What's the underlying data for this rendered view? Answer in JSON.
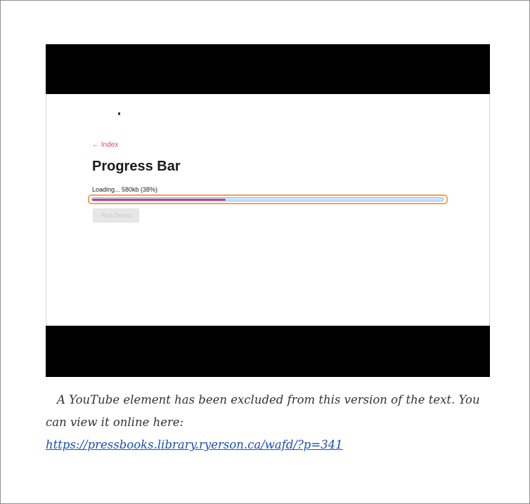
{
  "video": {
    "screen": {
      "index_link": "← Index",
      "title": "Progress Bar",
      "loading_text": "Loading... 580kb (38%)",
      "progress_percent": 38,
      "button_label": "Run Demo"
    }
  },
  "caption": {
    "text": "A YouTube element has been excluded from this version of the text. You can view it online here:",
    "link_text": "https://pressbooks.library.ryerson.ca/wafd/?p=341"
  },
  "colors": {
    "link": "#1a4fb5",
    "index_link": "#e8465a",
    "progress_fill": "#c8457a",
    "progress_track": "#cfe3f6",
    "focus_outline": "#f0a15a"
  }
}
